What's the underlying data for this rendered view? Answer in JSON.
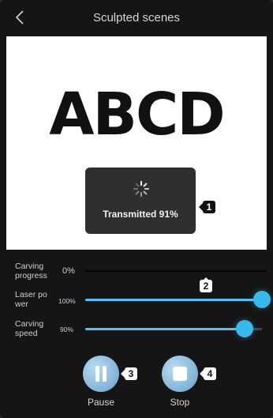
{
  "header": {
    "title": "Sculpted scenes",
    "back_icon": "chevron-left-icon"
  },
  "preview": {
    "text": "ABCD"
  },
  "toast": {
    "text": "Transmitted 91%",
    "transmitted_percent": 91
  },
  "badges": [
    "1",
    "2",
    "3",
    "4"
  ],
  "controls": {
    "progress": {
      "label": "Carving progress",
      "label_lines": [
        "Carving",
        "progress"
      ],
      "value": "0%",
      "percent": 0
    },
    "laser_power": {
      "label_lines": [
        "Laser po",
        "wer"
      ],
      "value": "100%",
      "percent": 100
    },
    "speed": {
      "label_lines": [
        "Carving",
        "speed"
      ],
      "value": "90%",
      "percent": 90
    }
  },
  "buttons": {
    "pause_label": "Pause",
    "stop_label": "Stop"
  },
  "colors": {
    "accent": "#36b9ec",
    "background": "#151515",
    "preview_bg": "#ffffff"
  }
}
